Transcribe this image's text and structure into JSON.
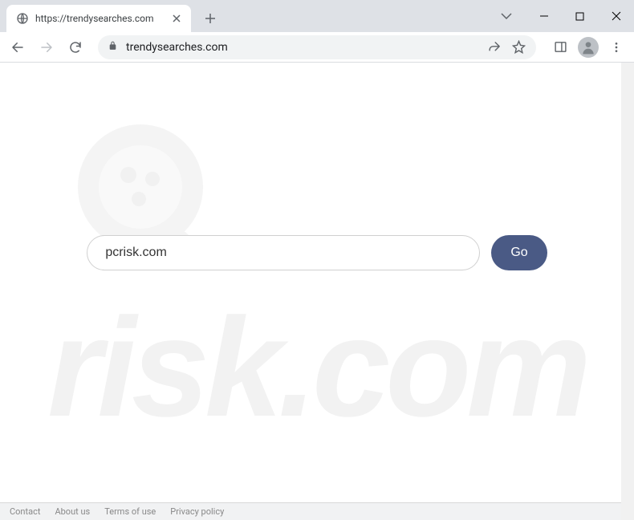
{
  "window": {
    "tab_title": "https://trendysearches.com",
    "address_text": "trendysearches.com"
  },
  "search": {
    "input_value": "pcrisk.com",
    "button_label": "Go"
  },
  "footer": {
    "links": [
      "Contact",
      "About us",
      "Terms of use",
      "Privacy policy"
    ]
  },
  "watermark": {
    "text": "risk.com"
  }
}
